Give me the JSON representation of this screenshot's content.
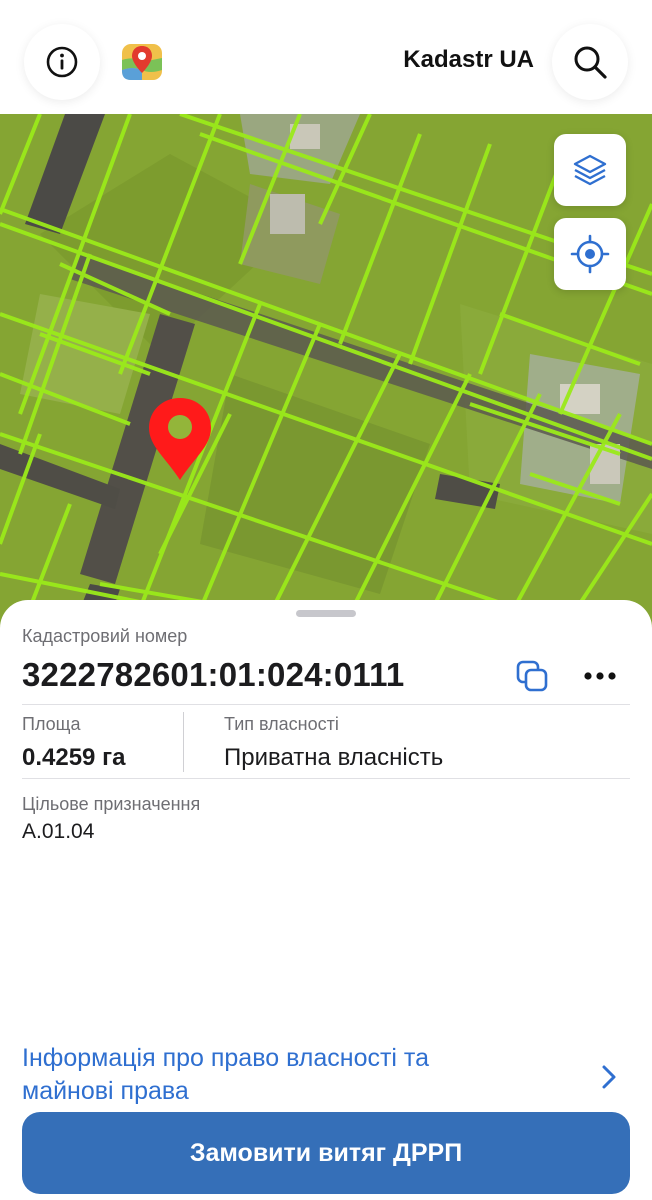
{
  "header": {
    "app_title": "Kadastr UA",
    "info_icon": "info-icon",
    "logo_icon": "map-pin-logo-icon",
    "search_icon": "search-icon"
  },
  "map": {
    "layers_icon": "layers-icon",
    "locate_icon": "crosshair-location-icon",
    "pin_icon": "location-pin-icon",
    "parcel_outline_color": "#9bea1a",
    "pin_color": "#ff1a1a"
  },
  "parcel": {
    "cadastral_label": "Кадастровий номер",
    "cadastral_number": "3222782601:01:024:0111",
    "area_label": "Площа",
    "area_value": "0.4259 га",
    "ownership_label": "Тип власності",
    "ownership_value": "Приватна власність",
    "purpose_label": "Цільове призначення",
    "purpose_value": "A.01.04"
  },
  "links": {
    "rights_info": "Інформація про право власності та майнові права"
  },
  "actions": {
    "order_extract": "Замовити витяг ДРРП"
  },
  "colors": {
    "accent": "#356fb8",
    "link": "#2f6fd0"
  }
}
